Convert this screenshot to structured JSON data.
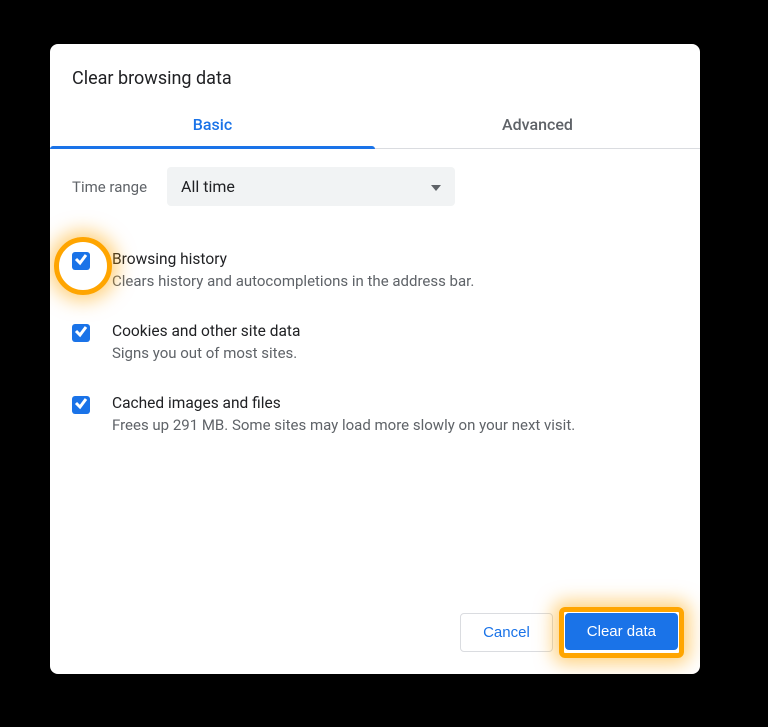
{
  "dialog": {
    "title": "Clear browsing data",
    "tabs": {
      "basic": "Basic",
      "advanced": "Advanced"
    },
    "timerange": {
      "label": "Time range",
      "value": "All time"
    },
    "options": [
      {
        "title": "Browsing history",
        "desc": "Clears history and autocompletions in the address bar."
      },
      {
        "title": "Cookies and other site data",
        "desc": "Signs you out of most sites."
      },
      {
        "title": "Cached images and files",
        "desc": "Frees up 291 MB. Some sites may load more slowly on your next visit."
      }
    ],
    "buttons": {
      "cancel": "Cancel",
      "clear": "Clear data"
    }
  }
}
